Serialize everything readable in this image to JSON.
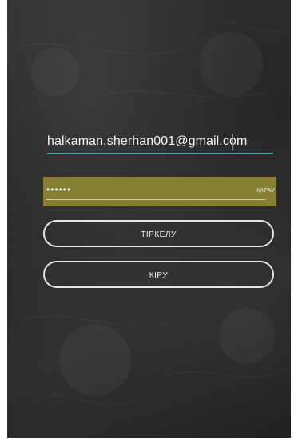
{
  "login_form": {
    "email_value": "halkaman.sherhan001@gmail.com",
    "password_masked": "••••••",
    "show_password_label": "ҚАРАУ",
    "register_label": "ТІРКЕЛУ",
    "login_label": "КІРУ"
  },
  "colors": {
    "background": "#2a2a2a",
    "accent_underline": "#37a7a0",
    "password_highlight": "#857f31",
    "button_border": "#e6e6e6"
  }
}
